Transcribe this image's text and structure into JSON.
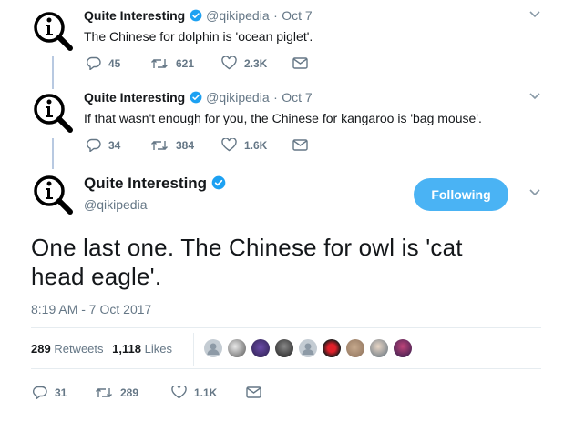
{
  "tweets": [
    {
      "name": "Quite Interesting",
      "handle": "@qikipedia",
      "date": "Oct 7",
      "text": "The Chinese for dolphin is 'ocean piglet'.",
      "replies": "45",
      "retweets": "621",
      "likes": "2.3K"
    },
    {
      "name": "Quite Interesting",
      "handle": "@qikipedia",
      "date": "Oct 7",
      "text": "If that wasn't enough for you, the Chinese for kangaroo is 'bag mouse'.",
      "replies": "34",
      "retweets": "384",
      "likes": "1.6K"
    }
  ],
  "main_tweet": {
    "name": "Quite Interesting",
    "handle": "@qikipedia",
    "follow_label": "Following",
    "text": "One last one. The Chinese for owl is 'cat head eagle'.",
    "timestamp": "8:19 AM - 7 Oct 2017",
    "retweet_count": "289",
    "retweet_label": "Retweets",
    "like_count": "1,118",
    "like_label": "Likes",
    "replies": "31",
    "retweets": "289",
    "likes": "1.1K"
  },
  "colors": {
    "verified": "#1da1f2",
    "follow_button": "#4ab3f4",
    "thread_line": "#b8c9e1",
    "muted": "#657786"
  }
}
